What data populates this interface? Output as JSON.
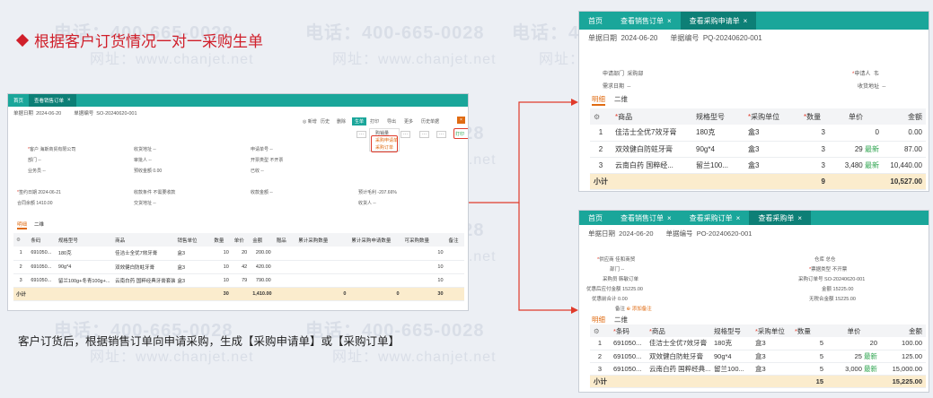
{
  "watermarks": {
    "phone": "电话：400-665-0028",
    "site": "网址：www.chanjet.net"
  },
  "heading": "根据客户订货情况一对一采购生单",
  "caption": "客户订货后，根据销售订单向申请采购，生成【采购申请单】或【采购订单】",
  "colors": {
    "accent": "#1aa69a",
    "highlight": "#d01f2a",
    "total_bg": "#fbeccd",
    "active_tab": "#e06b12"
  },
  "left": {
    "tabs": [
      "首页",
      "查看销售订单"
    ],
    "date_label": "单据日期",
    "date": "2024-06-20",
    "no_label": "单据编号",
    "no": "SO-20240620-001",
    "toolbar": [
      "◎ 新增",
      "历史",
      "删除",
      "生单",
      "打印",
      "导出",
      "更多",
      "历史单据"
    ],
    "dropdown_items": [
      "购销量",
      "采购申请单",
      "采购订单"
    ],
    "print_label": "打印",
    "fields": [
      [
        "客户",
        "海斯商贸有限公司"
      ],
      [
        "收货地址",
        "--"
      ],
      [
        "申请单号",
        "--"
      ],
      [
        "部门",
        "--"
      ],
      [
        "审批人",
        "--"
      ],
      [
        "开票类型",
        "不开票"
      ],
      [
        "业务员",
        "--"
      ],
      [
        "预收金额",
        "0.00"
      ],
      [
        "已收",
        "--"
      ],
      [
        "签约日期",
        "2024-06-21"
      ],
      [
        "收款条件",
        "不需要收款"
      ],
      [
        "收款金额",
        "--"
      ],
      [
        "预计毛利",
        "-207.66%"
      ],
      [
        "合同余额",
        "1410.00"
      ],
      [
        "交货地址",
        "--"
      ],
      [
        "收货人",
        "--"
      ]
    ],
    "sub_tabs": [
      "明细",
      "二维"
    ],
    "columns": [
      "条码",
      "规格型号",
      "商品",
      "销售单位",
      "数量",
      "单价",
      "金额",
      "赠品",
      "累计采购数量",
      "累计采购申请数量",
      "可采购数量",
      "备注"
    ],
    "rows": [
      [
        "1",
        "691050...",
        "180克",
        "佳洁士全优7效牙膏",
        "盒3",
        "10",
        "20",
        "200.00",
        "",
        "",
        "10"
      ],
      [
        "2",
        "691050...",
        "90g*4",
        "双效健白防蛀牙膏",
        "盒3",
        "10",
        "42",
        "420.00",
        "",
        "",
        "10"
      ],
      [
        "3",
        "691050...",
        "留兰100g+冬青100g+...",
        "云南白药 国粹经典牙膏套装",
        "盒3",
        "10",
        "79",
        "790.00",
        "",
        "",
        "10"
      ]
    ],
    "tag_latest": "最新",
    "total": {
      "label": "小计",
      "qty": "30",
      "amount": "1,410.00",
      "c1": "0",
      "c2": "0",
      "c3": "30"
    }
  },
  "rt": {
    "tabs": [
      "首页",
      "查看销售订单",
      "查看采购申请单"
    ],
    "date_label": "单据日期",
    "date": "2024-06-20",
    "no_label": "单据编号",
    "no": "PQ-20240620-001",
    "fields": [
      [
        "申请部门",
        "采购部"
      ],
      [
        "申请人",
        "韦"
      ],
      [
        "需求日期",
        "--"
      ],
      [
        "收货地址",
        "--"
      ]
    ],
    "sub_tabs": [
      "明细",
      "二维"
    ],
    "columns": [
      "商品",
      "规格型号",
      "采购单位",
      "数量",
      "单价",
      "金额"
    ],
    "rows": [
      [
        "1",
        "佳洁士全优7效牙膏",
        "180克",
        "盒3",
        "3",
        "0",
        "",
        "0.00"
      ],
      [
        "2",
        "双效健白防蛀牙膏",
        "90g*4",
        "盒3",
        "3",
        "29",
        "最新",
        "87.00"
      ],
      [
        "3",
        "云南白药 国粹经...",
        "留兰100...",
        "盒3",
        "3",
        "3,480",
        "最新",
        "10,440.00"
      ]
    ],
    "total": {
      "label": "小计",
      "qty": "9",
      "amount": "10,527.00"
    }
  },
  "rb": {
    "tabs": [
      "首页",
      "查看销售订单",
      "查看采购订单",
      "查看采购单"
    ],
    "date_label": "单据日期",
    "date": "2024-06-20",
    "no_label": "单据编号",
    "no": "PO-20240620-001",
    "fields": [
      [
        "供应商",
        "佳和商贸"
      ],
      [
        "仓库",
        "总仓"
      ],
      [
        "部门",
        "--"
      ],
      [
        "票据类型",
        "不开票"
      ],
      [
        "采购员",
        "韩敏订单"
      ],
      [
        "采购订单号",
        "SO-20240620-001"
      ],
      [
        "优惠后应付金额",
        "15225.00"
      ],
      [
        "金额",
        "15225.00"
      ],
      [
        "优惠前合计",
        "0.00"
      ],
      [
        "无税合金额",
        "15225.00"
      ],
      [
        "备注",
        "添加备注"
      ]
    ],
    "sub_tabs": [
      "明细",
      "二维"
    ],
    "columns": [
      "条码",
      "商品",
      "规格型号",
      "采购单位",
      "数量",
      "单价",
      "金额"
    ],
    "rows": [
      [
        "1",
        "691050...",
        "佳洁士全优7效牙膏",
        "180克",
        "盒3",
        "5",
        "20",
        "",
        "100.00"
      ],
      [
        "2",
        "691050...",
        "双效健白防蛀牙膏",
        "90g*4",
        "盒3",
        "5",
        "25",
        "最新",
        "125.00"
      ],
      [
        "3",
        "691050...",
        "云南白药 国粹经典...",
        "留兰100...",
        "盒3",
        "5",
        "3,000",
        "最新",
        "15,000.00"
      ]
    ],
    "total": {
      "label": "小计",
      "qty": "15",
      "amount": "15,225.00"
    }
  }
}
